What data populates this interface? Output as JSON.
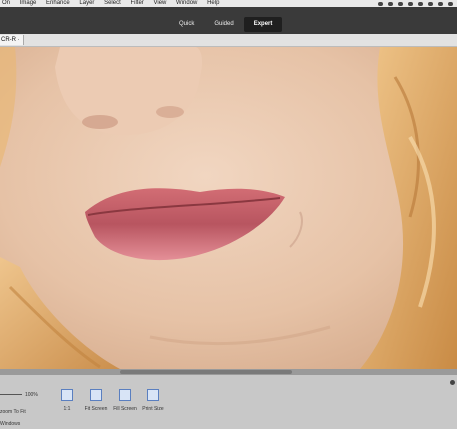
{
  "menubar": {
    "items": [
      "On",
      "Image",
      "Enhance",
      "Layer",
      "Select",
      "Filter",
      "View",
      "Window",
      "Help"
    ],
    "status_icons": [
      "notification-icon",
      "user-icon",
      "settings-icon",
      "circle-icon",
      "lock-icon",
      "bluetooth-icon",
      "wifi-icon",
      "battery-icon"
    ]
  },
  "modes": {
    "items": [
      "Quick",
      "Guided",
      "Expert"
    ],
    "active": "Expert"
  },
  "document_tab": {
    "label": "CR-R ·"
  },
  "bottom_panel": {
    "zoom_value": "100%",
    "label_zoom_to_fit": "zoom To Fit",
    "label_windows": "Windows",
    "view_buttons": [
      "1:1",
      "Fit Screen",
      "Fill Screen",
      "Print Size"
    ]
  },
  "colors": {
    "skin": "#e6c2a6",
    "lips": "#d77a80",
    "hair": "#e4b070",
    "panel": "#c8c8c8",
    "accent": "#5a7fc0"
  }
}
